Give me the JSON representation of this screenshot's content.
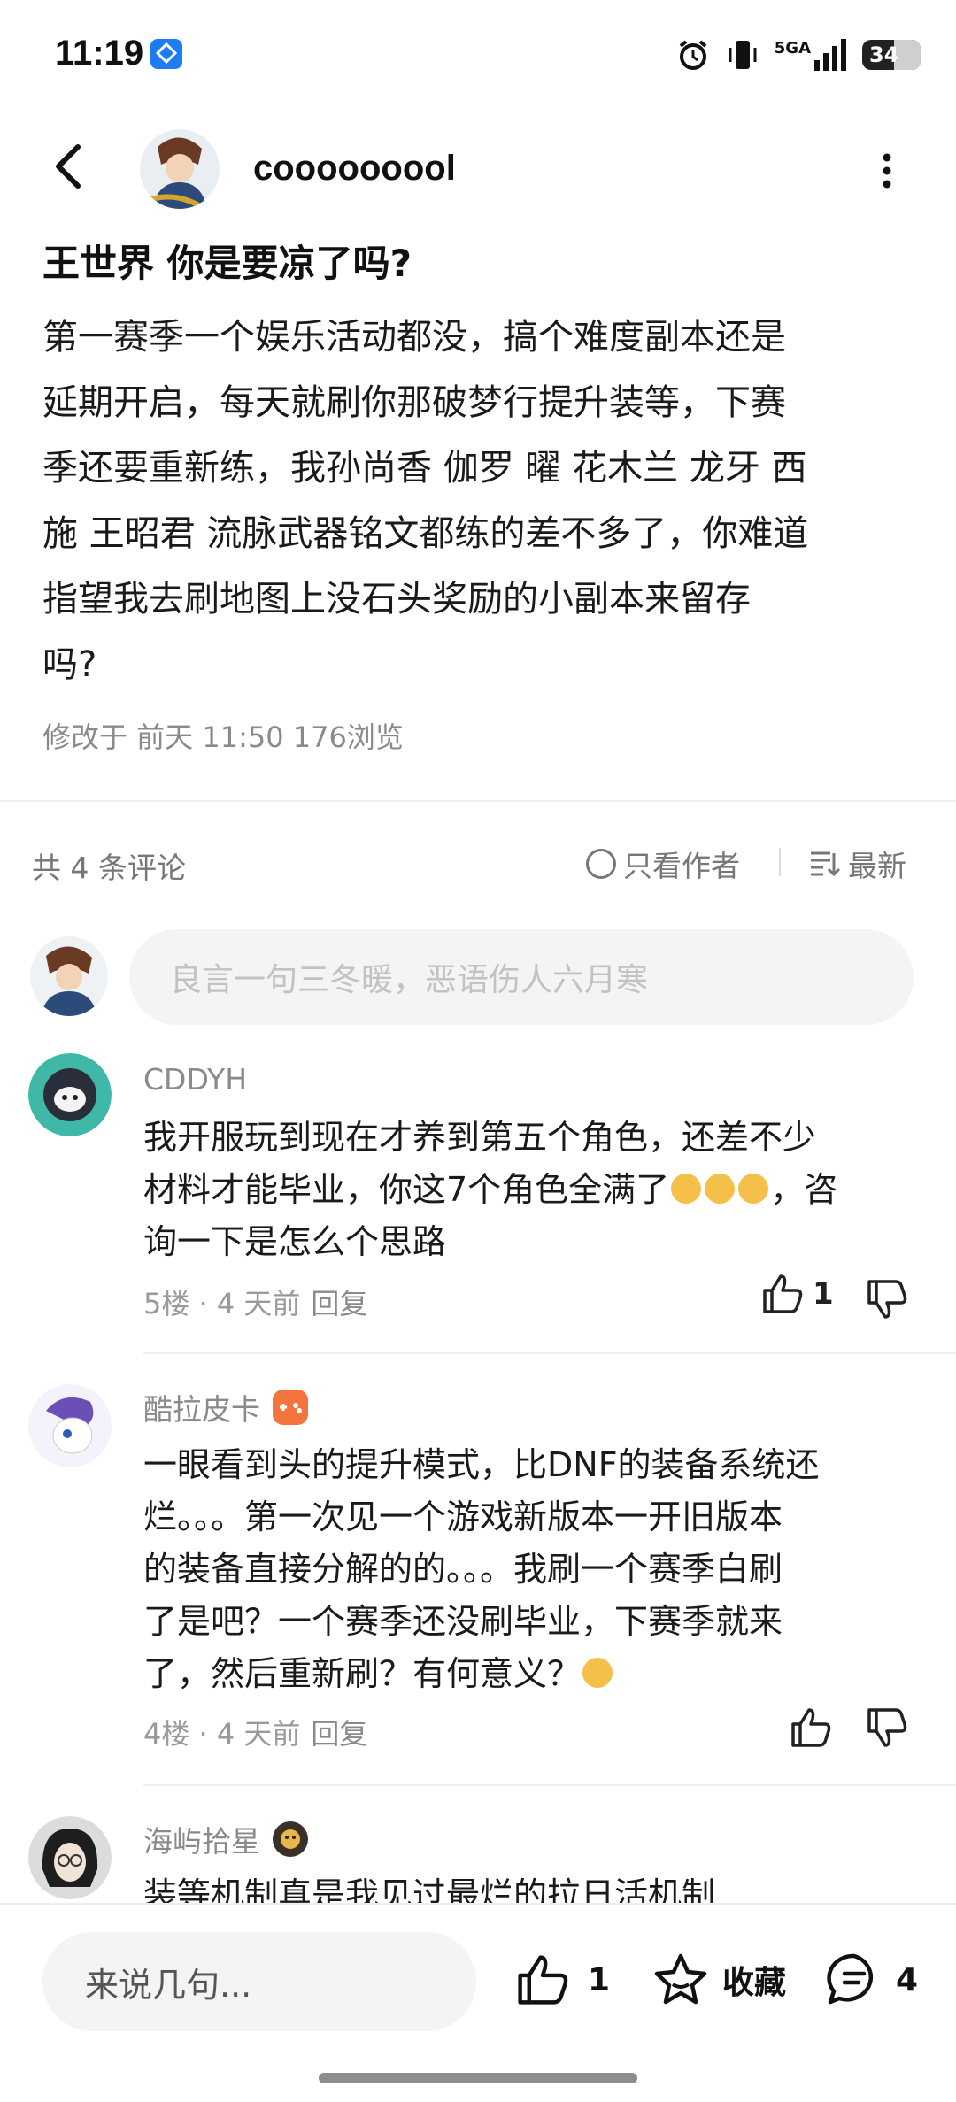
{
  "status_bar": {
    "time": "11:19",
    "network": "5GA",
    "battery": "34"
  },
  "header": {
    "author_name": "cooooooool"
  },
  "post": {
    "title": "王世界 你是要凉了吗?",
    "body_lines": [
      "第一赛季一个娱乐活动都没，搞个难度副本还是",
      "延期开启，每天就刷你那破梦行提升装等，下赛",
      "季还要重新练，我孙尚香 伽罗 曜 花木兰 龙牙 西",
      "施 王昭君 流脉武器铭文都练的差不多了，你难道",
      "指望我去刷地图上没石头奖励的小副本来留存",
      "吗?"
    ],
    "meta": "修改于 前天 11:50  176浏览"
  },
  "comments_header": {
    "count_label": "共 4 条评论",
    "only_author": "只看作者",
    "sort_label": "最新"
  },
  "comment_input": {
    "placeholder": "良言一句三冬暖，恶语伤人六月寒"
  },
  "comments": [
    {
      "name": "CDDYH",
      "text_lines": [
        "我开服玩到现在才养到第五个角色，还差不少",
        "材料才能毕业，你这7个角色全满了",
        "询一下是怎么个思路"
      ],
      "text_tail": "，咨",
      "floor": "5楼 · 4 天前",
      "reply": "回复",
      "likes": "1"
    },
    {
      "name": "酷拉皮卡",
      "text_lines": [
        "一眼看到头的提升模式，比DNF的装备系统还",
        "烂。。。第一次见一个游戏新版本一开旧版本",
        "的装备直接分解的的。。。我刷一个赛季白刷",
        "了是吧？一个赛季还没刷毕业，下赛季就来",
        "了，然后重新刷？有何意义？"
      ],
      "floor": "4楼 · 4 天前",
      "reply": "回复"
    },
    {
      "name": "海屿拾星",
      "text_lines": [
        "装等机制真是我见过最烂的拉日活机制"
      ]
    }
  ],
  "bottom_bar": {
    "input_placeholder": "来说几句...",
    "like_count": "1",
    "favorite_label": "收藏",
    "comment_count": "4"
  },
  "colors": {
    "accent_blue": "#1e7cf2",
    "text_primary": "#111111",
    "text_secondary": "#8a8a8a",
    "input_bg": "#f3f4f6"
  }
}
